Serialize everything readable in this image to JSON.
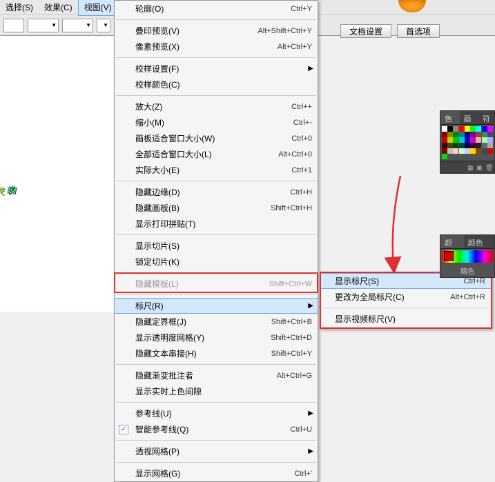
{
  "menubar": {
    "items": [
      {
        "label": "选择(S)"
      },
      {
        "label": "效果(C)"
      },
      {
        "label": "视图(V)",
        "active": true
      }
    ]
  },
  "toolbar": {
    "doc_settings": "文档设置",
    "preferences": "首选项"
  },
  "canvas_text": {
    "ch1": "尺",
    "ch2": "的"
  },
  "view_menu": [
    {
      "type": "item",
      "label": "轮廓(O)",
      "shortcut": "Ctrl+Y"
    },
    {
      "type": "sep"
    },
    {
      "type": "item",
      "label": "叠印预览(V)",
      "shortcut": "Alt+Shift+Ctrl+Y"
    },
    {
      "type": "item",
      "label": "像素预览(X)",
      "shortcut": "Alt+Ctrl+Y"
    },
    {
      "type": "sep"
    },
    {
      "type": "item",
      "label": "校样设置(F)",
      "submenu": true
    },
    {
      "type": "item",
      "label": "校样颜色(C)"
    },
    {
      "type": "sep"
    },
    {
      "type": "item",
      "label": "放大(Z)",
      "shortcut": "Ctrl++"
    },
    {
      "type": "item",
      "label": "缩小(M)",
      "shortcut": "Ctrl+-"
    },
    {
      "type": "item",
      "label": "画板适合窗口大小(W)",
      "shortcut": "Ctrl+0"
    },
    {
      "type": "item",
      "label": "全部适合窗口大小(L)",
      "shortcut": "Alt+Ctrl+0"
    },
    {
      "type": "item",
      "label": "实际大小(E)",
      "shortcut": "Ctrl+1"
    },
    {
      "type": "sep"
    },
    {
      "type": "item",
      "label": "隐藏边缘(D)",
      "shortcut": "Ctrl+H"
    },
    {
      "type": "item",
      "label": "隐藏画板(B)",
      "shortcut": "Shift+Ctrl+H"
    },
    {
      "type": "item",
      "label": "显示打印拼贴(T)"
    },
    {
      "type": "sep"
    },
    {
      "type": "item",
      "label": "显示切片(S)"
    },
    {
      "type": "item",
      "label": "锁定切片(K)"
    },
    {
      "type": "sep"
    },
    {
      "type": "item",
      "label": "隐藏模板(L)",
      "shortcut": "Shift+Ctrl+W",
      "disabled": true
    },
    {
      "type": "sep"
    },
    {
      "type": "item",
      "label": "标尺(R)",
      "submenu": true,
      "highlighted": true
    },
    {
      "type": "item",
      "label": "隐藏定界框(J)",
      "shortcut": "Shift+Ctrl+B"
    },
    {
      "type": "item",
      "label": "显示透明度网格(Y)",
      "shortcut": "Shift+Ctrl+D"
    },
    {
      "type": "item",
      "label": "隐藏文本串接(H)",
      "shortcut": "Shift+Ctrl+Y"
    },
    {
      "type": "sep"
    },
    {
      "type": "item",
      "label": "隐藏渐变批注者",
      "shortcut": "Alt+Ctrl+G"
    },
    {
      "type": "item",
      "label": "显示实时上色间隙"
    },
    {
      "type": "sep"
    },
    {
      "type": "item",
      "label": "参考线(U)",
      "submenu": true
    },
    {
      "type": "item",
      "label": "智能参考线(Q)",
      "shortcut": "Ctrl+U",
      "checked": true
    },
    {
      "type": "sep"
    },
    {
      "type": "item",
      "label": "透视网格(P)",
      "submenu": true
    },
    {
      "type": "sep"
    },
    {
      "type": "item",
      "label": "显示网格(G)",
      "shortcut": "Ctrl+'"
    }
  ],
  "ruler_submenu": [
    {
      "label": "显示标尺(S)",
      "shortcut": "Ctrl+R",
      "highlighted": true
    },
    {
      "label": "更改为全局标尺(C)",
      "shortcut": "Alt+Ctrl+R"
    },
    {
      "label": "显示视频标尺(V)"
    }
  ],
  "swatches_panel": {
    "tabs": [
      {
        "label": "色板",
        "active": true
      },
      {
        "label": "画笔"
      },
      {
        "label": "符"
      }
    ],
    "colors": [
      "#fff",
      "#000",
      "#888",
      "#f00",
      "#ff0",
      "#0f0",
      "#0ff",
      "#00f",
      "#f0f",
      "#800",
      "#880",
      "#080",
      "#088",
      "#008",
      "#808",
      "#844",
      "#484",
      "#448",
      "#c00",
      "#cc0",
      "#0c0",
      "#0cc",
      "#00c",
      "#c0c",
      "#faa",
      "#afa",
      "#aaf",
      "#400",
      "#440",
      "#040",
      "#044",
      "#004",
      "#404",
      "#222",
      "#666",
      "#aaa",
      "#800000",
      "#c0c0c0",
      "#ffcccc",
      "#ccffcc",
      "#ccccff",
      "#ffd700",
      "#8b4513",
      "#2f4f4f",
      "#d00",
      "#0d0"
    ]
  },
  "color_panel": {
    "tabs": [
      {
        "label": "颜色",
        "active": true
      },
      {
        "label": "颜色参"
      }
    ],
    "label": "暗色"
  }
}
